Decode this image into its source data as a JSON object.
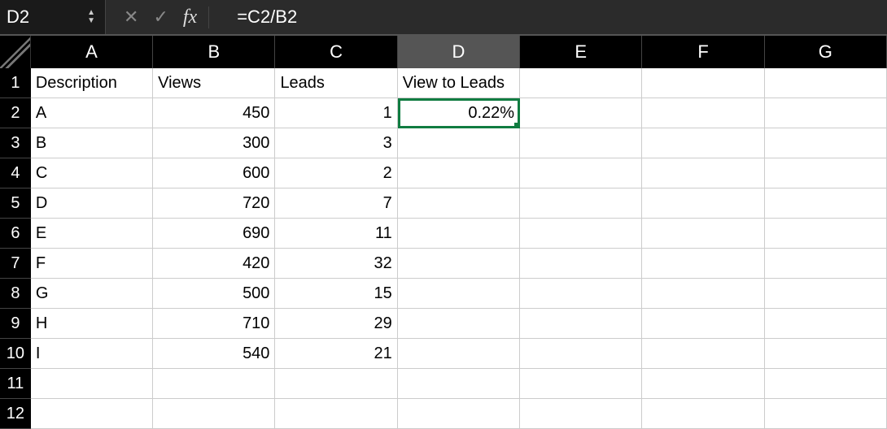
{
  "formula_bar": {
    "cell_reference": "D2",
    "fx_label": "fx",
    "formula": "=C2/B2"
  },
  "columns": [
    "A",
    "B",
    "C",
    "D",
    "E",
    "F",
    "G"
  ],
  "active_column_index": 3,
  "selected_cell": {
    "row": 2,
    "col": "D"
  },
  "row_numbers": [
    "1",
    "2",
    "3",
    "4",
    "5",
    "6",
    "7",
    "8",
    "9",
    "10",
    "11",
    "12"
  ],
  "headers": {
    "A": "Description",
    "B": "Views",
    "C": "Leads",
    "D": "View to Leads"
  },
  "data_rows": [
    {
      "A": "A",
      "B": "450",
      "C": "1",
      "D": "0.22%"
    },
    {
      "A": "B",
      "B": "300",
      "C": "3",
      "D": ""
    },
    {
      "A": "C",
      "B": "600",
      "C": "2",
      "D": ""
    },
    {
      "A": "D",
      "B": "720",
      "C": "7",
      "D": ""
    },
    {
      "A": "E",
      "B": "690",
      "C": "11",
      "D": ""
    },
    {
      "A": "F",
      "B": "420",
      "C": "32",
      "D": ""
    },
    {
      "A": "G",
      "B": "500",
      "C": "15",
      "D": ""
    },
    {
      "A": "H",
      "B": "710",
      "C": "29",
      "D": ""
    },
    {
      "A": "I",
      "B": "540",
      "C": "21",
      "D": ""
    }
  ]
}
